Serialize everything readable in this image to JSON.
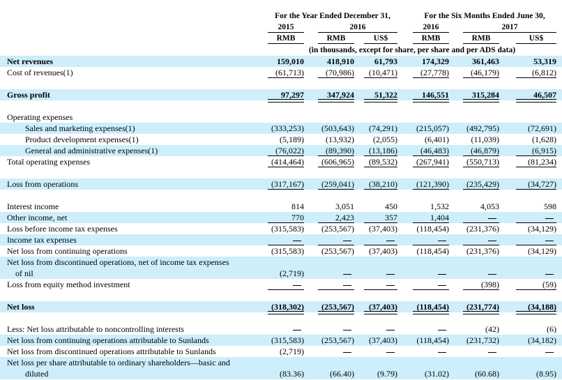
{
  "header": {
    "year_group": "For the Year Ended December 31,",
    "six_month_group": "For the Six Months Ended June 30,",
    "years": [
      "2015",
      "2016",
      "2016",
      "2017"
    ],
    "currencies": [
      "RMB",
      "RMB",
      "US$",
      "RMB",
      "RMB",
      "US$"
    ],
    "unit_note": "(in thousands, except for share, per share and per ADS data)"
  },
  "rows": [
    {
      "label": "Net revenues",
      "values": [
        "159,010",
        "418,910",
        "61,793",
        "174,329",
        "361,463",
        "53,319"
      ],
      "bold": true,
      "shaded": true
    },
    {
      "label": "Cost of revenues(1)",
      "values": [
        "(61,713)",
        "(70,986)",
        "(10,471)",
        "(27,778)",
        "(46,179)",
        "(6,812)"
      ],
      "ul": "single"
    },
    {
      "label": "Gross profit",
      "values": [
        "97,297",
        "347,924",
        "51,322",
        "146,551",
        "315,284",
        "46,507"
      ],
      "bold": true,
      "shaded": true,
      "ul": "double"
    },
    {
      "label": "Operating expenses",
      "values": [
        "",
        "",
        "",
        "",
        "",
        ""
      ]
    },
    {
      "label": "Sales and marketing expenses(1)",
      "values": [
        "(333,253)",
        "(503,643)",
        "(74,291)",
        "(215,057)",
        "(492,795)",
        "(72,691)"
      ],
      "shaded": true,
      "indent": true
    },
    {
      "label": "Product development expenses(1)",
      "values": [
        "(5,189)",
        "(13,932)",
        "(2,055)",
        "(6,401)",
        "(11,039)",
        "(1,628)"
      ],
      "indent": true
    },
    {
      "label": "General and administrative expenses(1)",
      "values": [
        "(76,022)",
        "(89,390)",
        "(13,186)",
        "(46,483)",
        "(46,879)",
        "(6,915)"
      ],
      "shaded": true,
      "indent": true,
      "ul": "single"
    },
    {
      "label": "Total operating expenses",
      "values": [
        "(414,464)",
        "(606,965)",
        "(89,532)",
        "(267,941)",
        "(550,713)",
        "(81,234)"
      ],
      "ul": "single"
    },
    {
      "label": "Loss from operations",
      "values": [
        "(317,167)",
        "(259,041)",
        "(38,210)",
        "(121,390)",
        "(235,429)",
        "(34,727)"
      ],
      "shaded": true,
      "ul": "single"
    },
    {
      "label": "Interest income",
      "values": [
        "814",
        "3,051",
        "450",
        "1,532",
        "4,053",
        "598"
      ]
    },
    {
      "label": "Other income, net",
      "values": [
        "770",
        "2,423",
        "357",
        "1,404",
        "—",
        "—"
      ],
      "shaded": true,
      "ul": "single"
    },
    {
      "label": "Loss before income tax expenses",
      "values": [
        "(315,583)",
        "(253,567)",
        "(37,403)",
        "(118,454)",
        "(231,376)",
        "(34,129)"
      ]
    },
    {
      "label": "Income tax expenses",
      "values": [
        "—",
        "—",
        "—",
        "—",
        "—",
        "—"
      ],
      "shaded": true,
      "ul": "single"
    },
    {
      "label": "Net loss from continuing operations",
      "values": [
        "(315,583)",
        "(253,567)",
        "(37,403)",
        "(118,454)",
        "(231,376)",
        "(34,129)"
      ]
    },
    {
      "label": "Net loss from discontinued operations, net of income tax expenses",
      "values": [
        "",
        "",
        "",
        "",
        "",
        ""
      ],
      "shaded": true
    },
    {
      "label": "of nil",
      "values": [
        "(2,719)",
        "—",
        "—",
        "—",
        "—",
        "—"
      ],
      "shaded": true,
      "indent": true
    },
    {
      "label": "Loss from equity method investment",
      "values": [
        "—",
        "—",
        "—",
        "—",
        "(398)",
        "(59)"
      ],
      "ul": "single"
    },
    {
      "label": "Net loss",
      "values": [
        "(318,302)",
        "(253,567)",
        "(37,403)",
        "(118,454)",
        "(231,774)",
        "(34,188)"
      ],
      "bold": true,
      "shaded": true,
      "ul": "double"
    },
    {
      "label": "Less: Net loss attributable to noncontrolling interests",
      "values": [
        "—",
        "—",
        "—",
        "—",
        "(42)",
        "(6)"
      ]
    },
    {
      "label": "Net loss from continuing operations attributable to Sunlands",
      "values": [
        "(315,583)",
        "(253,567)",
        "(37,403)",
        "(118,454)",
        "(231,732)",
        "(34,182)"
      ],
      "shaded": true
    },
    {
      "label": "Net loss from discontinued operations attributable to Sunlands",
      "values": [
        "(2,719)",
        "—",
        "—",
        "—",
        "—",
        "—"
      ]
    },
    {
      "label": "Net loss per share attributable to ordinary shareholders—basic and",
      "values": [
        "",
        "",
        "",
        "",
        "",
        ""
      ],
      "shaded": true
    },
    {
      "label": "diluted",
      "values": [
        "(83.36)",
        "(66.40)",
        "(9.79)",
        "(31.02)",
        "(60.68)",
        "(8.95)"
      ],
      "shaded": true,
      "indent": true
    }
  ]
}
